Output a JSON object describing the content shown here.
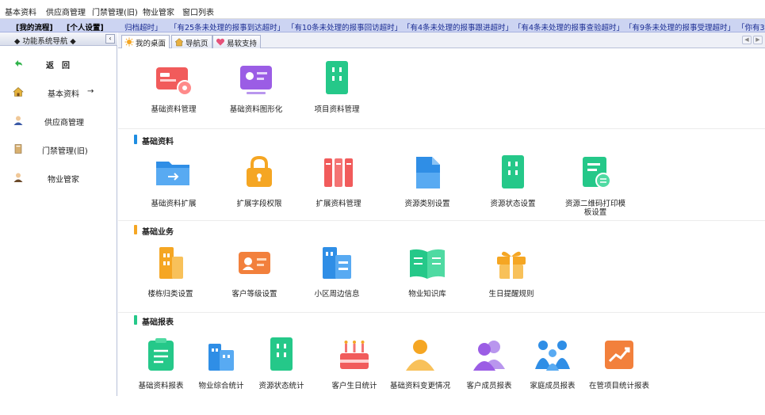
{
  "menubar": [
    "基本资料",
    "供应商管理",
    "门禁管理(旧)",
    "物业管家",
    "窗口列表"
  ],
  "ticker": {
    "left_buttons": [
      "[我的流程]",
      "[个人设置]"
    ],
    "notices": [
      "归档超时」",
      "「有25条未处理的报事到达超时」",
      "「有10条未处理的报事回访超时」",
      "「有4条未处理的报事跟进超时」",
      "「有4条未处理的报事查验超时」",
      "「有9条未处理的报事受理超时」",
      "「你有3"
    ]
  },
  "sidebar": {
    "title": "功能系统导航",
    "collapse_glyph": "‹",
    "items": [
      {
        "label": "返　回",
        "icon": "back-arrow-icon"
      },
      {
        "label": "基本资料",
        "icon": "house-icon",
        "arrow": "→"
      },
      {
        "label": "供应商管理",
        "icon": "person-icon"
      },
      {
        "label": "门禁管理(旧)",
        "icon": "book-icon"
      },
      {
        "label": "物业管家",
        "icon": "person-icon"
      }
    ]
  },
  "tabs": [
    "我的桌面",
    "导航页",
    "易软支持"
  ],
  "tab_nav": {
    "prev": "◀",
    "next": "▶"
  },
  "sections": [
    "基础资料",
    "基础业务",
    "基础报表"
  ],
  "tiles": {
    "top": [
      "基础资料管理",
      "基础资料图形化",
      "项目资料管理"
    ],
    "basic_data": [
      "基础资料扩展",
      "扩展字段权限",
      "扩展资料管理",
      "资源类别设置",
      "资源状态设置",
      "资源二维码打印模板设置"
    ],
    "basic_business": [
      "楼栋归类设置",
      "客户等级设置",
      "小区周边信息",
      "物业知识库",
      "生日提醒规则"
    ],
    "basic_reports": [
      "基础资料报表",
      "物业综合统计",
      "资源状态统计",
      "客户生日统计",
      "基础资料变更情况",
      "客户成员报表",
      "家庭成员报表",
      "在管项目统计报表"
    ]
  },
  "colors": {
    "blue": "#2f8ee6",
    "red": "#f15b5b",
    "green": "#25c889",
    "orange": "#f5a623",
    "purple": "#9b5de5"
  }
}
